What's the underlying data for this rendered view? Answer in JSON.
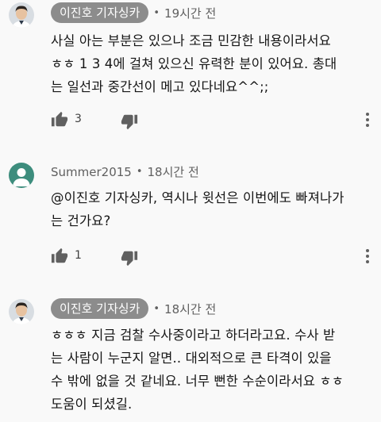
{
  "comments": [
    {
      "author": "이진호 기자싱카",
      "time": "19시간 전",
      "lines": [
        "사실 아는 부분은 있으나 조금 민감한 내용이라서요",
        "ㅎㅎ 1 3 4에 걸쳐 있으신 유력한 분이 있어요. 총대",
        "는 일선과 중간선이 메고 있다네요^^;;"
      ],
      "likes": "3"
    },
    {
      "author": "Summer2015",
      "time": "18시간 전",
      "lines": [
        "@이진호 기자싱카, 역시나 윗선은 이번에도 빠져나가",
        "는 건가요?"
      ],
      "likes": "1"
    },
    {
      "author": "이진호 기자싱카",
      "time": "18시간 전",
      "lines": [
        "ㅎㅎㅎ 지금 검찰 수사중이라고 하더라고요. 수사 받",
        "는 사람이 누군지 알면.. 대외적으로 큰 타격이 있을",
        "수 밖에 없을 것 같네요. 너무 뻔한 수순이라서요 ㅎㅎ",
        "도움이 되셨길."
      ]
    }
  ],
  "separator": "•",
  "icons": {
    "like": "thumbs-up-icon",
    "dislike": "thumbs-down-icon",
    "more": "more-vert-icon"
  },
  "colors": {
    "background": "#f9f9f9",
    "badge": "#8c8c8c",
    "meta_text": "#606060",
    "icon": "#606060",
    "summer_avatar": "#3d8d7d"
  }
}
